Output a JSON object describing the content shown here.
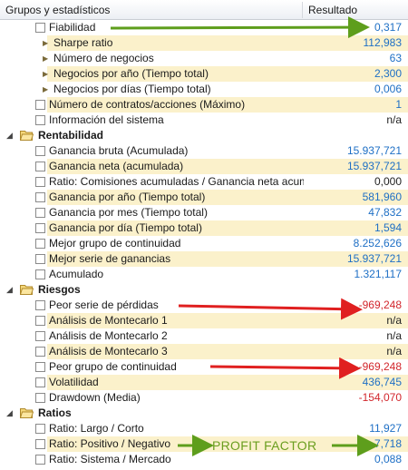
{
  "header": {
    "col_name": "Grupos y estadísticos",
    "col_result": "Resultado"
  },
  "rows": [
    {
      "kind": "item",
      "indent": 1,
      "cb": true,
      "hl": false,
      "label": "Fiabilidad",
      "value": "0,317",
      "color": "blue"
    },
    {
      "kind": "item",
      "indent": 2,
      "tri": true,
      "hl": true,
      "label": "Sharpe ratio",
      "value": "112,983",
      "color": "blue"
    },
    {
      "kind": "item",
      "indent": 2,
      "tri": true,
      "hl": false,
      "label": "Número de negocios",
      "value": "63",
      "color": "blue"
    },
    {
      "kind": "item",
      "indent": 2,
      "tri": true,
      "hl": true,
      "label": "Negocios por año (Tiempo total)",
      "value": "2,300",
      "color": "blue"
    },
    {
      "kind": "item",
      "indent": 2,
      "tri": true,
      "hl": false,
      "label": "Negocios por días (Tiempo total)",
      "value": "0,006",
      "color": "blue"
    },
    {
      "kind": "item",
      "indent": 1,
      "cb": true,
      "hl": true,
      "label": "Número de contratos/acciones (Máximo)",
      "value": "1",
      "color": "blue"
    },
    {
      "kind": "item",
      "indent": 1,
      "cb": true,
      "hl": false,
      "label": "Información del sistema",
      "value": "n/a",
      "color": "dark"
    },
    {
      "kind": "group",
      "label": "Rentabilidad"
    },
    {
      "kind": "item",
      "indent": 1,
      "cb": true,
      "hl": false,
      "label": "Ganancia bruta (Acumulada)",
      "value": "15.937,721",
      "color": "blue"
    },
    {
      "kind": "item",
      "indent": 1,
      "cb": true,
      "hl": true,
      "label": "Ganancia neta (acumulada)",
      "value": "15.937,721",
      "color": "blue"
    },
    {
      "kind": "item",
      "indent": 1,
      "cb": true,
      "hl": false,
      "label": "Ratio: Comisiones acumuladas / Ganancia neta acum",
      "value": "0,000",
      "color": "dark"
    },
    {
      "kind": "item",
      "indent": 1,
      "cb": true,
      "hl": true,
      "label": "Ganancia por año (Tiempo total)",
      "value": "581,960",
      "color": "blue"
    },
    {
      "kind": "item",
      "indent": 1,
      "cb": true,
      "hl": false,
      "label": "Ganancia por mes (Tiempo total)",
      "value": "47,832",
      "color": "blue"
    },
    {
      "kind": "item",
      "indent": 1,
      "cb": true,
      "hl": true,
      "label": "Ganancia por día (Tiempo total)",
      "value": "1,594",
      "color": "blue"
    },
    {
      "kind": "item",
      "indent": 1,
      "cb": true,
      "hl": false,
      "label": "Mejor grupo de continuidad",
      "value": "8.252,626",
      "color": "blue"
    },
    {
      "kind": "item",
      "indent": 1,
      "cb": true,
      "hl": true,
      "label": "Mejor serie de ganancias",
      "value": "15.937,721",
      "color": "blue"
    },
    {
      "kind": "item",
      "indent": 1,
      "cb": true,
      "hl": false,
      "label": "Acumulado",
      "value": "1.321,117",
      "color": "blue"
    },
    {
      "kind": "group",
      "label": "Riesgos"
    },
    {
      "kind": "item",
      "indent": 1,
      "cb": true,
      "hl": false,
      "label": "Peor serie de pérdidas",
      "value": "-969,248",
      "color": "red"
    },
    {
      "kind": "item",
      "indent": 1,
      "cb": true,
      "hl": true,
      "label": "Análisis de Montecarlo 1",
      "value": "n/a",
      "color": "dark"
    },
    {
      "kind": "item",
      "indent": 1,
      "cb": true,
      "hl": false,
      "label": "Análisis de Montecarlo 2",
      "value": "n/a",
      "color": "dark"
    },
    {
      "kind": "item",
      "indent": 1,
      "cb": true,
      "hl": true,
      "label": "Análisis de Montecarlo 3",
      "value": "n/a",
      "color": "dark"
    },
    {
      "kind": "item",
      "indent": 1,
      "cb": true,
      "hl": false,
      "label": "Peor grupo de continuidad",
      "value": "-969,248",
      "color": "red"
    },
    {
      "kind": "item",
      "indent": 1,
      "cb": true,
      "hl": true,
      "label": "Volatilidad",
      "value": "436,745",
      "color": "blue"
    },
    {
      "kind": "item",
      "indent": 1,
      "cb": true,
      "hl": false,
      "label": "Drawdown (Media)",
      "value": "-154,070",
      "color": "red"
    },
    {
      "kind": "group",
      "label": "Ratios"
    },
    {
      "kind": "item",
      "indent": 1,
      "cb": true,
      "hl": false,
      "label": "Ratio: Largo / Corto",
      "value": "11,927",
      "color": "blue"
    },
    {
      "kind": "item",
      "indent": 1,
      "cb": true,
      "hl": true,
      "label": "Ratio: Positivo / Negativo",
      "value": "7,718",
      "color": "blue"
    },
    {
      "kind": "item",
      "indent": 1,
      "cb": true,
      "hl": false,
      "label": "Ratio: Sistema / Mercado",
      "value": "0,088",
      "color": "blue"
    }
  ],
  "annotation": {
    "profit_factor_label": "PROFIT FACTOR",
    "green": "#5e9e1c",
    "red": "#e02020"
  }
}
